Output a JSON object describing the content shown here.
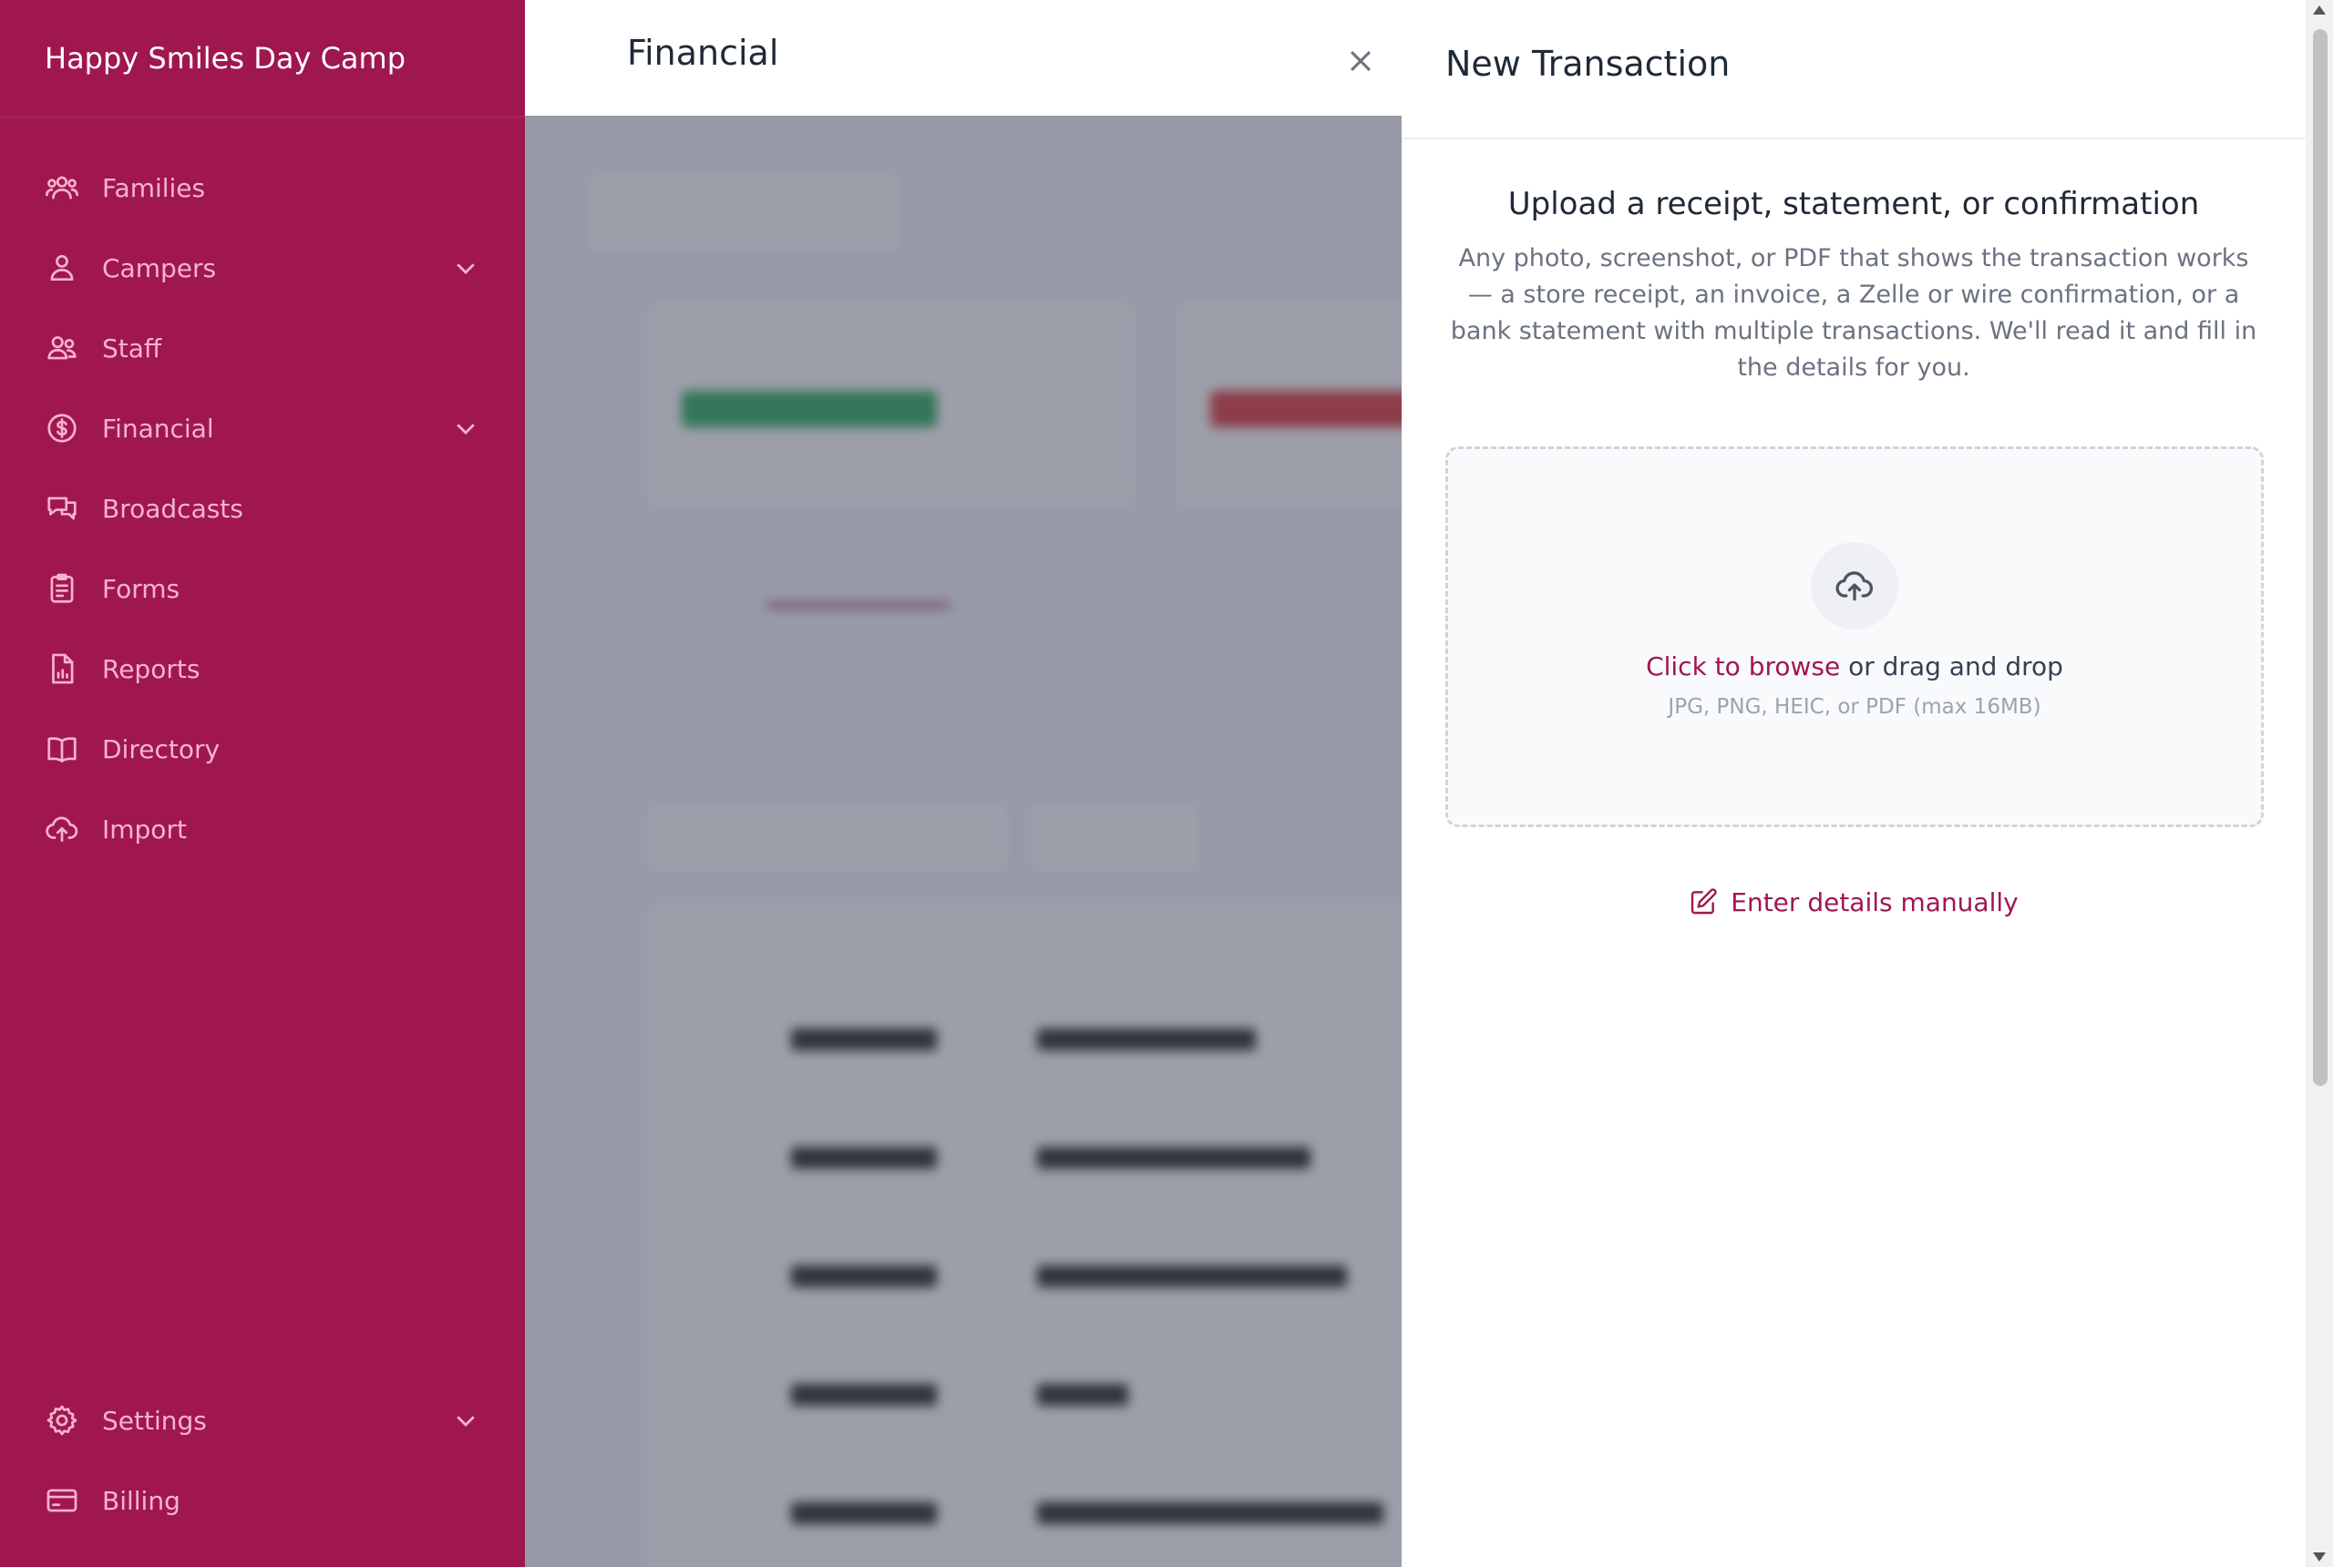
{
  "sidebar": {
    "brand": "Happy Smiles Day Camp",
    "items": [
      {
        "label": "Families",
        "icon": "users-icon"
      },
      {
        "label": "Campers",
        "icon": "user-icon"
      },
      {
        "label": "Staff",
        "icon": "user-group-icon"
      },
      {
        "label": "Financial",
        "icon": "dollar-circle-icon"
      },
      {
        "label": "Broadcasts",
        "icon": "chat-bubbles-icon"
      },
      {
        "label": "Forms",
        "icon": "clipboard-icon"
      },
      {
        "label": "Reports",
        "icon": "document-chart-icon"
      },
      {
        "label": "Directory",
        "icon": "book-open-icon"
      },
      {
        "label": "Import",
        "icon": "cloud-upload-icon"
      }
    ],
    "bottom": [
      {
        "label": "Settings",
        "icon": "cog-icon"
      },
      {
        "label": "Billing",
        "icon": "credit-card-icon"
      }
    ]
  },
  "header": {
    "title": "Financial"
  },
  "panel": {
    "title": "New Transaction",
    "heading": "Upload a receipt, statement, or confirmation",
    "description": "Any photo, screenshot, or PDF that shows the transaction works — a store receipt, an invoice, a Zelle or wire confirmation, or a bank statement with multiple transactions. We'll read it and fill in the details for you.",
    "dropzone": {
      "browse": "Click to browse",
      "drag": " or drag and drop",
      "formats": "JPG, PNG, HEIC, or PDF (max 16MB)"
    },
    "manual": "Enter details manually"
  },
  "colors": {
    "brand": "#a0174f",
    "nav_text": "#f5b3cd"
  }
}
